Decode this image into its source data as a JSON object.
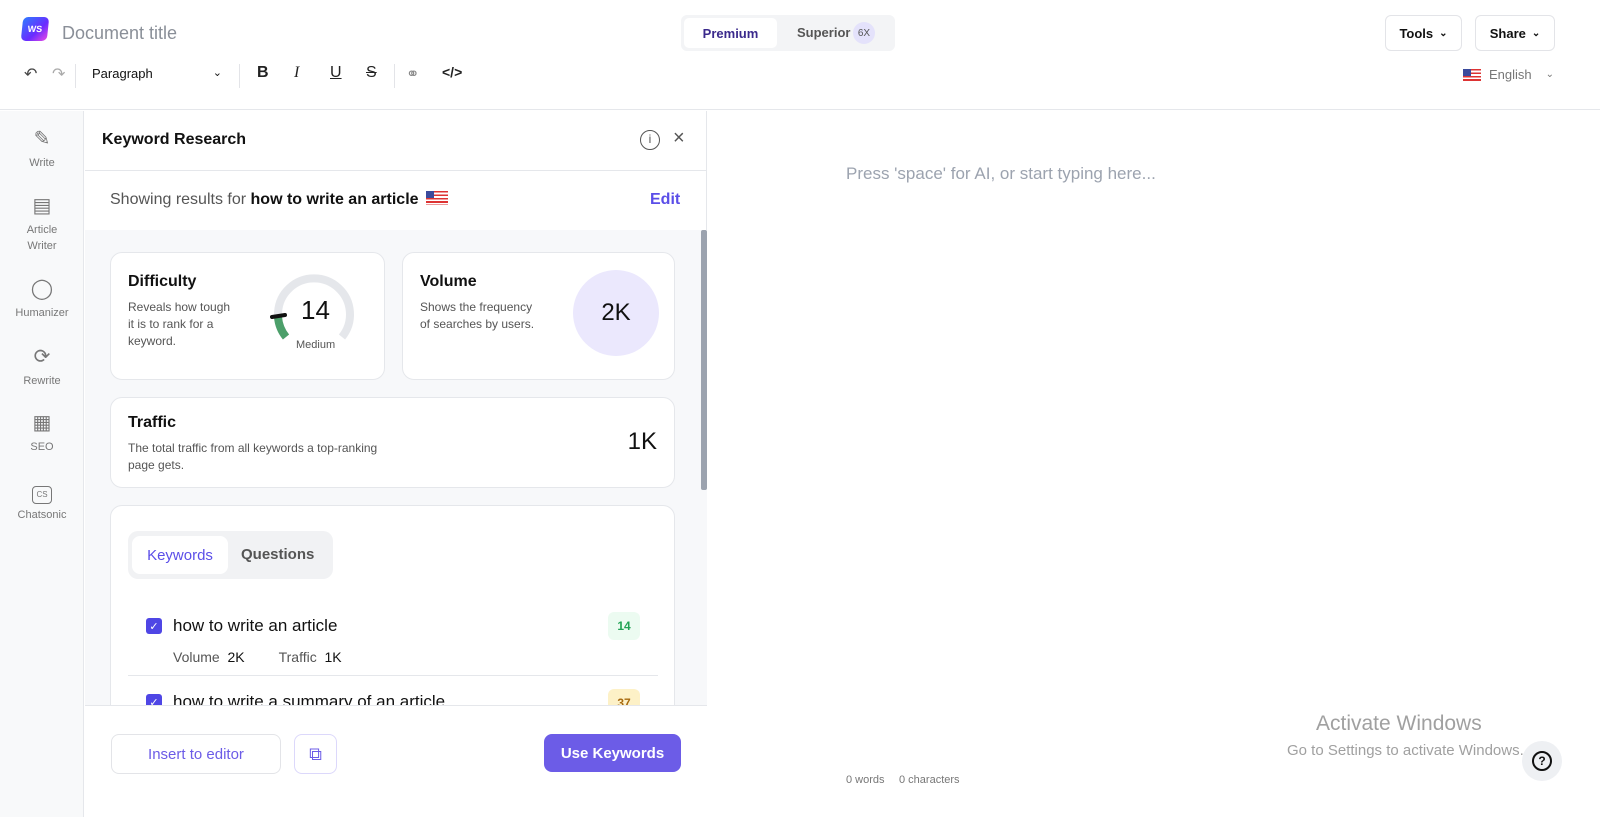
{
  "header": {
    "logo_text": "WS",
    "doc_title": "Document title",
    "plans": {
      "premium": "Premium",
      "superior": "Superior",
      "superior_badge": "6X"
    },
    "tools": "Tools",
    "share": "Share",
    "language": "English"
  },
  "toolbar": {
    "block_format": "Paragraph"
  },
  "sidebar": {
    "items": [
      {
        "label": "Write",
        "icon": "pencil-doc-icon"
      },
      {
        "label": "Article\nWriter",
        "icon": "article-icon"
      },
      {
        "label": "Humanizer",
        "icon": "person-icon"
      },
      {
        "label": "Rewrite",
        "icon": "refresh-icon"
      },
      {
        "label": "SEO",
        "icon": "chart-window-icon"
      },
      {
        "label": "Chatsonic",
        "icon": "cs-icon"
      }
    ]
  },
  "panel": {
    "title": "Keyword Research",
    "showing_prefix": "Showing results for ",
    "query": "how to write an article",
    "edit": "Edit",
    "difficulty": {
      "title": "Difficulty",
      "desc": "Reveals how tough it is to rank for a keyword.",
      "value": "14",
      "level": "Medium",
      "color": "#4c9f6a"
    },
    "volume": {
      "title": "Volume",
      "desc": "Shows the frequency of searches by users.",
      "value": "2K"
    },
    "traffic": {
      "title": "Traffic",
      "desc": "The total traffic from all keywords a top-ranking page gets.",
      "value": "1K"
    },
    "tabs": [
      "Keywords",
      "Questions"
    ],
    "keywords": [
      {
        "text": "how to write an article",
        "difficulty": "14",
        "volume_label": "Volume",
        "volume": "2K",
        "traffic_label": "Traffic",
        "traffic": "1K",
        "checked": true
      },
      {
        "text": "how to write a summary of an article",
        "difficulty": "37",
        "checked": true
      }
    ],
    "insert": "Insert to editor",
    "use": "Use Keywords"
  },
  "editor": {
    "placeholder": "Press 'space' for AI, or start typing here...",
    "words": "0 words",
    "chars": "0 characters"
  },
  "watermark": {
    "title": "Activate Windows",
    "sub": "Go to Settings to activate Windows."
  },
  "colors": {
    "accent": "#6c5ce7",
    "brand": "#4f46e5"
  }
}
